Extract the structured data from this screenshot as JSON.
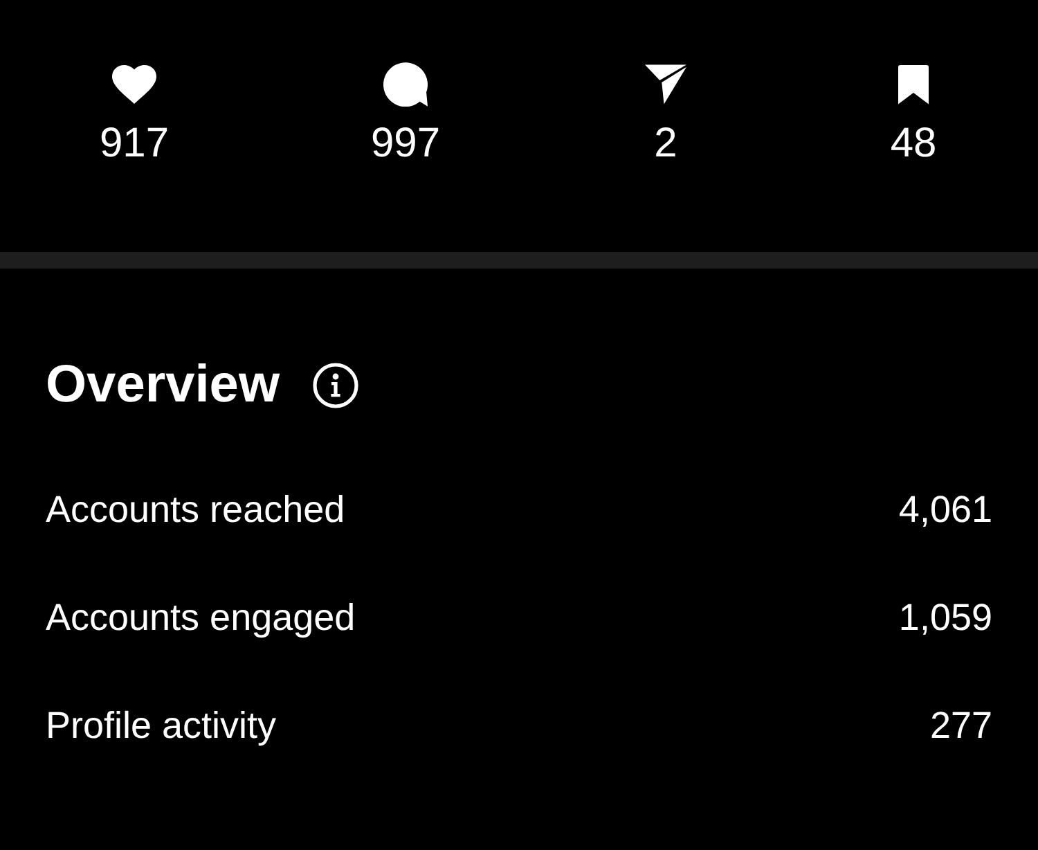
{
  "stats": [
    {
      "kind": "likes",
      "value": "917"
    },
    {
      "kind": "comments",
      "value": "997"
    },
    {
      "kind": "shares",
      "value": "2"
    },
    {
      "kind": "saves",
      "value": "48"
    }
  ],
  "overview": {
    "title": "Overview",
    "rows": [
      {
        "label": "Accounts reached",
        "value": "4,061"
      },
      {
        "label": "Accounts engaged",
        "value": "1,059"
      },
      {
        "label": "Profile activity",
        "value": "277"
      }
    ]
  }
}
